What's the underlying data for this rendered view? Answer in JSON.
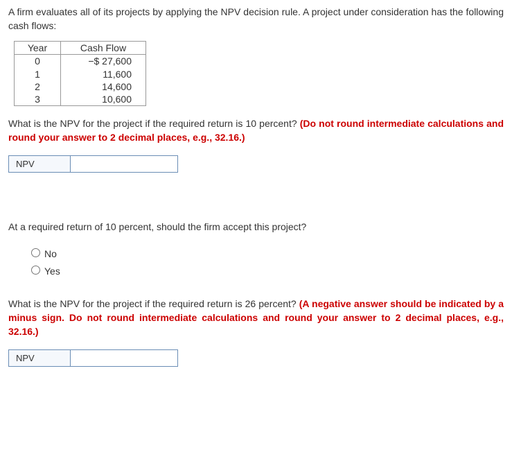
{
  "intro": "A firm evaluates all of its projects by applying the NPV decision rule. A project under consideration has the following cash flows:",
  "table": {
    "header_year": "Year",
    "header_cashflow": "Cash Flow",
    "rows": [
      {
        "year": "0",
        "cf": "−$ 27,600"
      },
      {
        "year": "1",
        "cf": "11,600"
      },
      {
        "year": "2",
        "cf": "14,600"
      },
      {
        "year": "3",
        "cf": "10,600"
      }
    ]
  },
  "q1": {
    "text": "What is the NPV for the project if the required return is 10 percent? ",
    "instr": "(Do not round intermediate calculations and round your answer to 2 decimal places, e.g., 32.16.)",
    "label": "NPV"
  },
  "q2": {
    "text": "At a required return of 10 percent, should the firm accept this project?",
    "opt_no": "No",
    "opt_yes": "Yes"
  },
  "q3": {
    "text": "What is the NPV for the project if the required return is 26 percent? ",
    "instr": "(A negative answer should be indicated by a minus sign. Do not round intermediate calculations and round your answer to 2 decimal places, e.g., 32.16.)",
    "label": "NPV"
  }
}
